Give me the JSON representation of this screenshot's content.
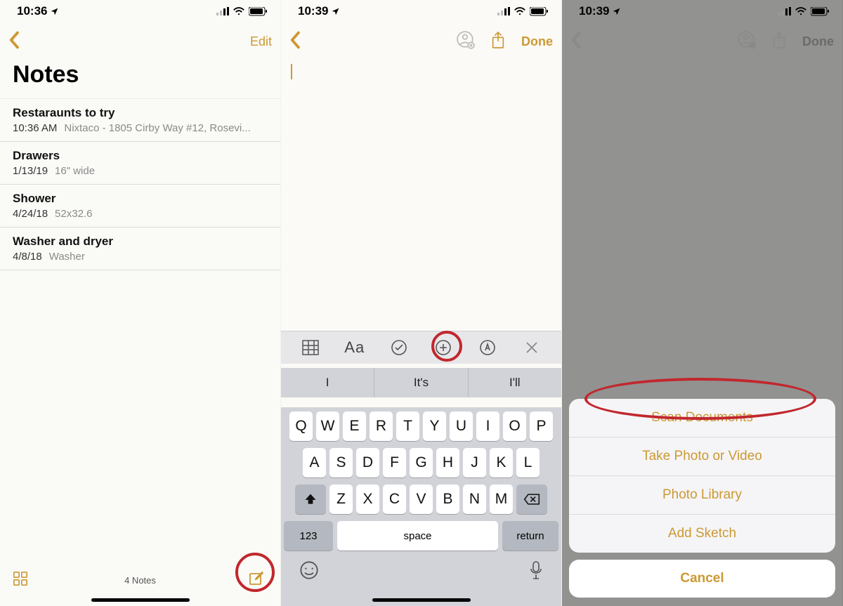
{
  "screen1": {
    "statusTime": "10:36",
    "editLabel": "Edit",
    "title": "Notes",
    "notes": [
      {
        "title": "Restaraunts to try",
        "time": "10:36 AM",
        "detail": "Nixtaco - 1805 Cirby Way #12, Rosevi..."
      },
      {
        "title": "Drawers",
        "time": "1/13/19",
        "detail": "16\" wide"
      },
      {
        "title": "Shower",
        "time": "4/24/18",
        "detail": "52x32.6"
      },
      {
        "title": "Washer and dryer",
        "time": "4/8/18",
        "detail": "Washer"
      }
    ],
    "countLabel": "4 Notes"
  },
  "screen2": {
    "statusTime": "10:39",
    "doneLabel": "Done",
    "toolbar": {
      "aa": "Aa"
    },
    "suggestions": [
      "I",
      "It's",
      "I'll"
    ],
    "rows": [
      [
        "Q",
        "W",
        "E",
        "R",
        "T",
        "Y",
        "U",
        "I",
        "O",
        "P"
      ],
      [
        "A",
        "S",
        "D",
        "F",
        "G",
        "H",
        "J",
        "K",
        "L"
      ],
      [
        "Z",
        "X",
        "C",
        "V",
        "B",
        "N",
        "M"
      ]
    ],
    "numKey": "123",
    "spaceKey": "space",
    "returnKey": "return"
  },
  "screen3": {
    "statusTime": "10:39",
    "doneLabel": "Done",
    "options": [
      "Scan Documents",
      "Take Photo or Video",
      "Photo Library",
      "Add Sketch"
    ],
    "cancel": "Cancel"
  }
}
